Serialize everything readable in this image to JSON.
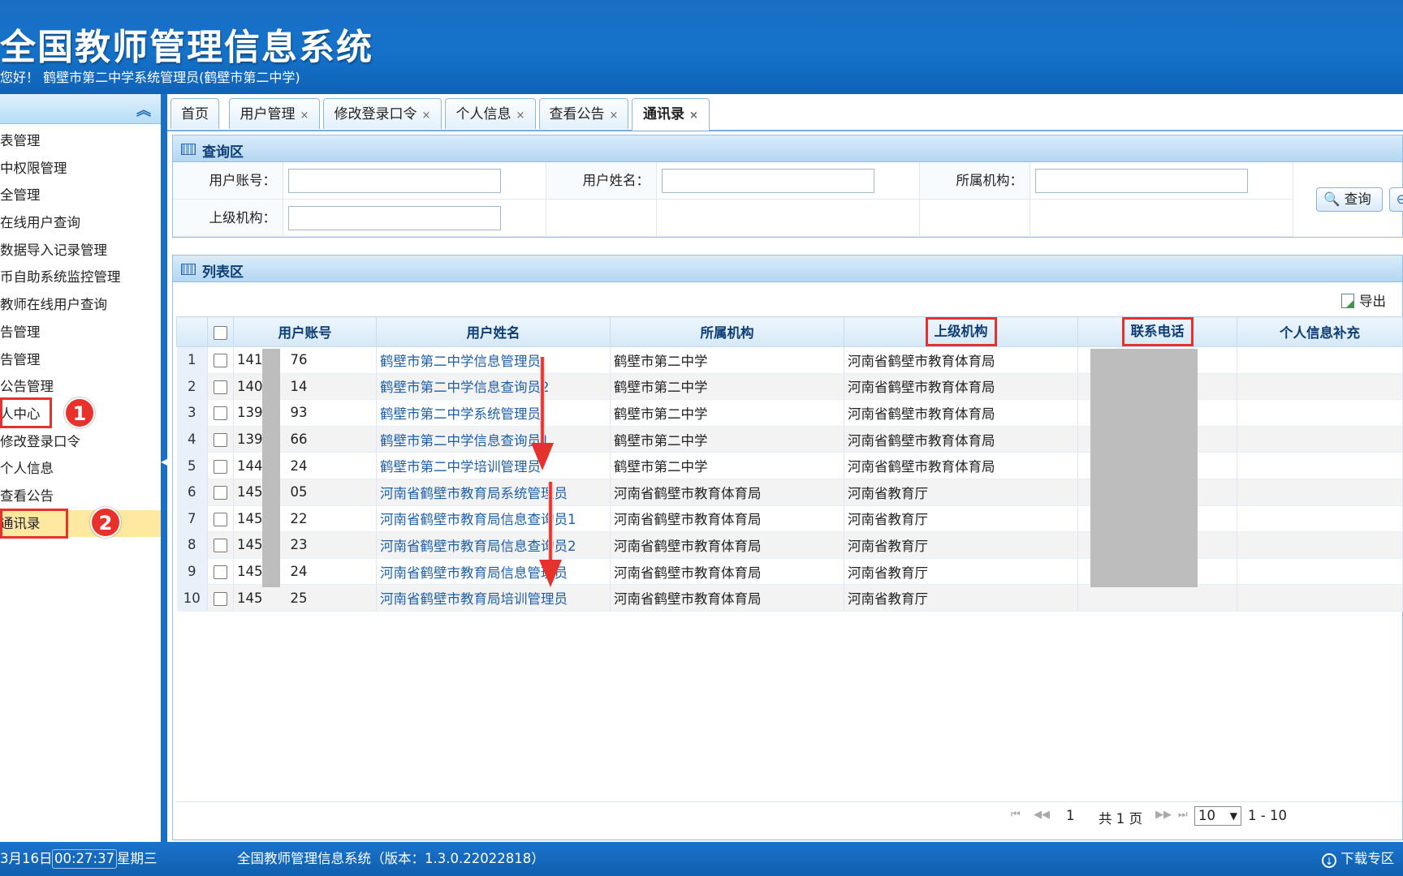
{
  "header": {
    "title": "全国教师管理信息系统",
    "welcome": "您好！ 鹤壁市第二中学系统管理员(鹤壁市第二中学)"
  },
  "sidebar": {
    "items": [
      {
        "label": "表管理"
      },
      {
        "label": "中权限管理"
      },
      {
        "label": "全管理"
      },
      {
        "label": "在线用户查询"
      },
      {
        "label": "数据导入记录管理"
      },
      {
        "label": "币自助系统监控管理"
      },
      {
        "label": "教师在线用户查询"
      },
      {
        "label": "告管理"
      },
      {
        "label": "告管理"
      },
      {
        "label": "公告管理"
      },
      {
        "label": "人中心"
      },
      {
        "label": "修改登录口令"
      },
      {
        "label": "个人信息"
      },
      {
        "label": "查看公告"
      },
      {
        "label": "通讯录"
      }
    ],
    "selected_index": 14,
    "badges": [
      "1",
      "2"
    ]
  },
  "tabs": [
    {
      "label": "首页",
      "closable": false
    },
    {
      "label": "用户管理",
      "closable": true
    },
    {
      "label": "修改登录口令",
      "closable": true
    },
    {
      "label": "个人信息",
      "closable": true
    },
    {
      "label": "查看公告",
      "closable": true
    },
    {
      "label": "通讯录",
      "closable": true,
      "active": true
    }
  ],
  "tab_close_glyph": "×",
  "query": {
    "title": "查询区",
    "account_label": "用户账号：",
    "name_label": "用户姓名：",
    "org_label": "所属机构：",
    "parent_label": "上级机构：",
    "search_button": "查询"
  },
  "list": {
    "title": "列表区",
    "export_label": "导出",
    "columns": [
      "用户账号",
      "用户姓名",
      "所属机构",
      "上级机构",
      "联系电话",
      "个人信息补充"
    ],
    "rows": [
      {
        "no": "1",
        "account_prefix": "141",
        "account_suffix": "76",
        "name": "鹤壁市第二中学信息管理员",
        "org": "鹤壁市第二中学",
        "parent": "河南省鹤壁市教育体育局"
      },
      {
        "no": "2",
        "account_prefix": "140",
        "account_suffix": "14",
        "name": "鹤壁市第二中学信息查询员2",
        "org": "鹤壁市第二中学",
        "parent": "河南省鹤壁市教育体育局"
      },
      {
        "no": "3",
        "account_prefix": "139",
        "account_suffix": "93",
        "name": "鹤壁市第二中学系统管理员",
        "org": "鹤壁市第二中学",
        "parent": "河南省鹤壁市教育体育局"
      },
      {
        "no": "4",
        "account_prefix": "139",
        "account_suffix": "66",
        "name": "鹤壁市第二中学信息查询员1",
        "org": "鹤壁市第二中学",
        "parent": "河南省鹤壁市教育体育局"
      },
      {
        "no": "5",
        "account_prefix": "144",
        "account_suffix": "24",
        "name": "鹤壁市第二中学培训管理员",
        "org": "鹤壁市第二中学",
        "parent": "河南省鹤壁市教育体育局"
      },
      {
        "no": "6",
        "account_prefix": "145",
        "account_suffix": "05",
        "name": "河南省鹤壁市教育局系统管理员",
        "org": "河南省鹤壁市教育体育局",
        "parent": "河南省教育厅"
      },
      {
        "no": "7",
        "account_prefix": "145",
        "account_suffix": "22",
        "name": "河南省鹤壁市教育局信息查询员1",
        "org": "河南省鹤壁市教育体育局",
        "parent": "河南省教育厅"
      },
      {
        "no": "8",
        "account_prefix": "145",
        "account_suffix": "23",
        "name": "河南省鹤壁市教育局信息查询员2",
        "org": "河南省鹤壁市教育体育局",
        "parent": "河南省教育厅"
      },
      {
        "no": "9",
        "account_prefix": "145",
        "account_suffix": "24",
        "name": "河南省鹤壁市教育局信息管理员",
        "org": "河南省鹤壁市教育体育局",
        "parent": "河南省教育厅"
      },
      {
        "no": "10",
        "account_prefix": "145",
        "account_suffix": "25",
        "name": "河南省鹤壁市教育局培训管理员",
        "org": "河南省鹤壁市教育体育局",
        "parent": "河南省教育厅"
      }
    ]
  },
  "pager": {
    "page": "1",
    "total": "共 1 页",
    "page_size": "10",
    "range": "1 - 10"
  },
  "footer": {
    "date": "3月16日",
    "time": "00:27:37",
    "weekday": "星期三",
    "system": "全国教师管理信息系统（版本：1.3.0.22022818）",
    "download": "下载专区"
  },
  "colors": {
    "header_blue": "#1572c9",
    "highlight_red": "#e5322d",
    "selected_row": "#ffe8a0",
    "link_blue": "#1d5fa8"
  }
}
